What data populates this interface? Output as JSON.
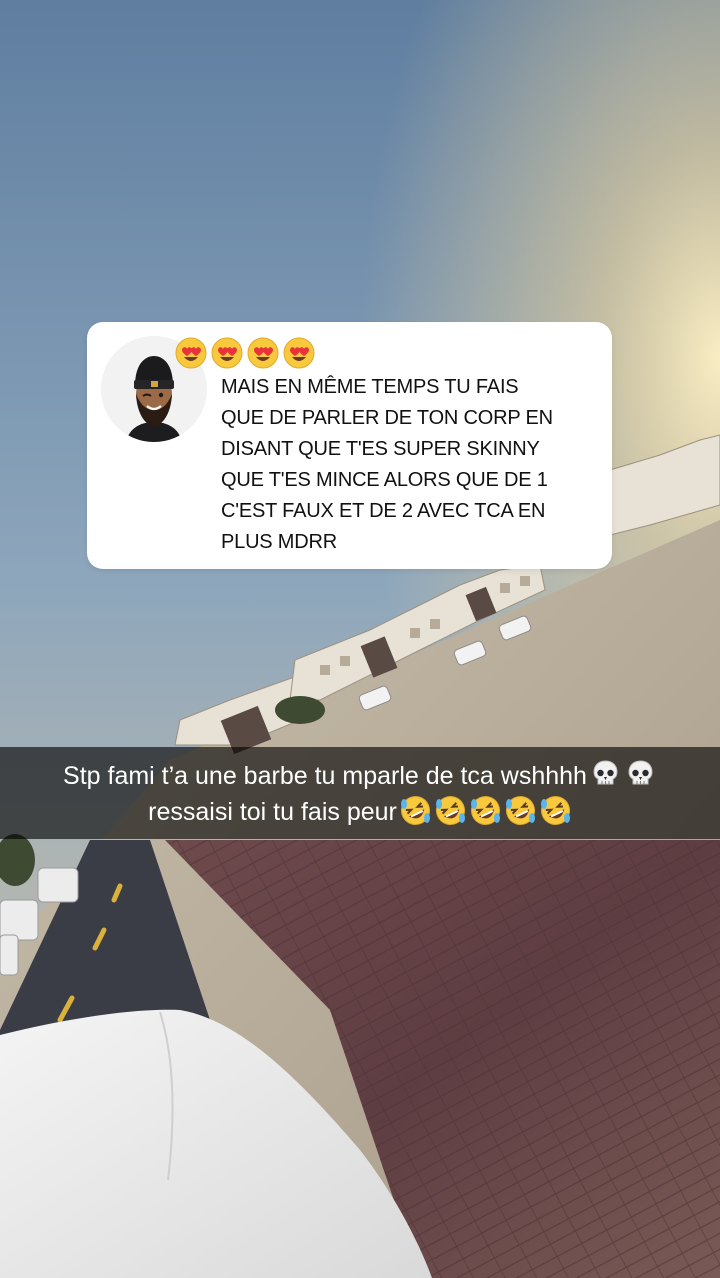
{
  "question_card": {
    "avatar_icon": "bitmoji-avatar-icon",
    "reaction_emojis": [
      "heart-eyes-emoji",
      "heart-eyes-emoji",
      "heart-eyes-emoji",
      "heart-eyes-emoji"
    ],
    "lines": [
      "MAIS EN MÊME TEMPS TU FAIS",
      "QUE DE PARLER DE TON CORP EN",
      "DISANT QUE T'ES SUPER SKINNY",
      "QUE T'ES MINCE ALORS QUE DE 1",
      "C'EST FAUX ET DE 2 AVEC TCA EN",
      "PLUS MDRR"
    ]
  },
  "caption": {
    "line1": "Stp fami t’a une barbe tu mparle de tca wshhhh",
    "line1_emojis": [
      "skull-emoji",
      "skull-emoji"
    ],
    "line2": "ressaisi toi tu fais peur",
    "line2_emojis": [
      "rofl-emoji",
      "rofl-emoji",
      "rofl-emoji",
      "rofl-emoji",
      "rofl-emoji"
    ]
  },
  "colors": {
    "card_bg": "#ffffff",
    "caption_bg": "rgba(0,0,0,0.62)",
    "caption_text": "#ffffff",
    "question_text": "#111111"
  }
}
